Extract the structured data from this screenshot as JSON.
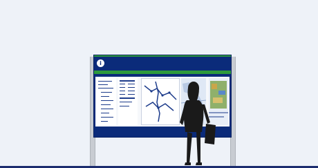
{
  "board": {
    "info_icon": "info-icon",
    "title": "",
    "logo_text": "",
    "accent_color": "#2e9a3c",
    "board_color": "#0b2b7a"
  },
  "scene": {
    "background_color": "#eef2f8",
    "person_icon": "woman-silhouette"
  }
}
